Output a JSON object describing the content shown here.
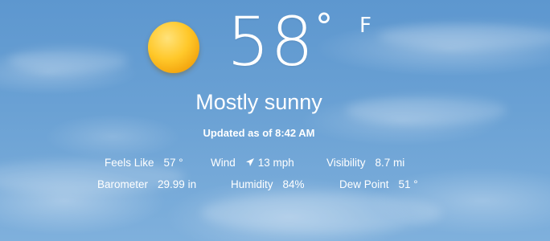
{
  "current": {
    "temperature": "58",
    "degree_symbol": "°",
    "unit": "F",
    "condition": "Mostly sunny",
    "updated": "Updated as of 8:42 AM",
    "weather_icon": "sun-icon",
    "colors": {
      "sky": "#6aa1d4",
      "sun": "#ffc82a",
      "text": "#ffffff"
    }
  },
  "details": {
    "feels_like": {
      "label": "Feels Like",
      "value": "57 °"
    },
    "wind": {
      "label": "Wind",
      "value": "13 mph",
      "icon": "wind-direction-arrow-icon"
    },
    "visibility": {
      "label": "Visibility",
      "value": "8.7 mi"
    },
    "barometer": {
      "label": "Barometer",
      "value": "29.99 in"
    },
    "humidity": {
      "label": "Humidity",
      "value": "84%"
    },
    "dew_point": {
      "label": "Dew Point",
      "value": "51 °"
    }
  }
}
